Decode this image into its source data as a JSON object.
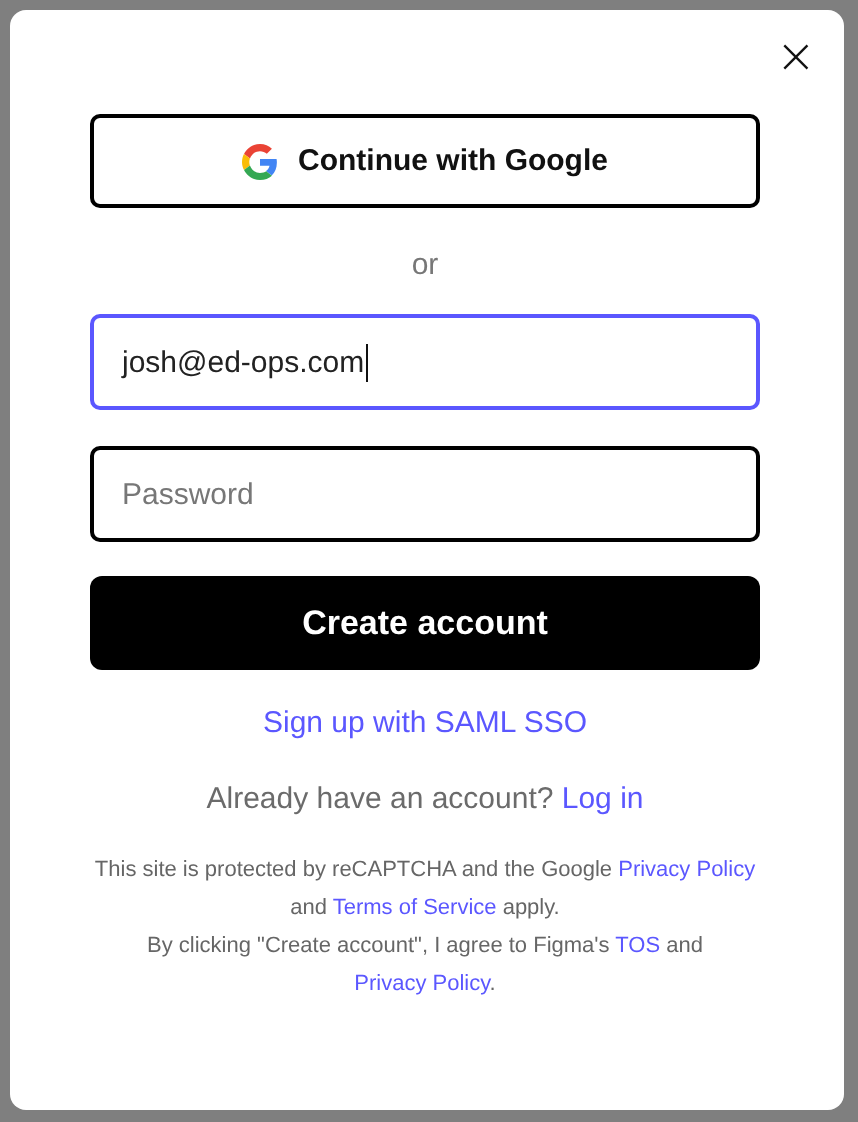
{
  "dialog": {
    "close": "×"
  },
  "google_button": {
    "label": "Continue with Google"
  },
  "divider": "or",
  "email": {
    "value": "josh@ed-ops.com",
    "focused": true
  },
  "password": {
    "placeholder": "Password",
    "focused": false
  },
  "submit": {
    "label": "Create account"
  },
  "saml_link": "Sign up with SAML SSO",
  "login_prompt": {
    "text": "Already have an account?",
    "link": "Log in"
  },
  "legal": [
    [
      {
        "kind": "text",
        "text": "This site is protected by reCAPTCHA and the Google "
      },
      {
        "kind": "link",
        "text": "Privacy Policy"
      },
      {
        "kind": "text",
        "text": " and "
      },
      {
        "kind": "link",
        "text": "Terms of Service"
      },
      {
        "kind": "text",
        "text": " apply."
      }
    ],
    [
      {
        "kind": "text",
        "text": "By clicking \"Create account\", I agree to Figma's "
      },
      {
        "kind": "link",
        "text": "TOS"
      },
      {
        "kind": "text",
        "text": " and "
      },
      {
        "kind": "link",
        "text": "Privacy Policy"
      },
      {
        "kind": "text",
        "text": "."
      }
    ]
  ]
}
